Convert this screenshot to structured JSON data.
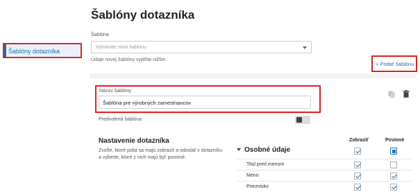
{
  "sidebar": {
    "items": [
      {
        "label": "Šablóny dotazníka",
        "active": true
      }
    ]
  },
  "main": {
    "title": "Šablóny dotazníka",
    "template_select": {
      "label": "Šablóna",
      "placeholder": "Vytvárate novú šablónu"
    },
    "hint": "Údaje novej šablóny vyplňte nižšie.",
    "add_button": "+ Pridať šablónu"
  },
  "card": {
    "name_label": "Názov šablóny",
    "name_value": "Šablóna pre výrobných zamestnancov",
    "default_label": "Predvolená šablóna",
    "default_toggle": false,
    "settings_title": "Nastavenie dotazníka",
    "settings_desc": "Zvoľte, ktoré polia sa majú zobraziť a odoslať v dotazníku a vyberte, ktoré z nich majú byť povinné.",
    "columns": {
      "show": "Zobraziť",
      "required": "Povinné"
    },
    "section": {
      "title": "Osobné údaje",
      "show": true,
      "required": "partial",
      "rows": [
        {
          "label": "Titul pred menom",
          "show": true,
          "required": false
        },
        {
          "label": "Meno",
          "show": true,
          "required": true
        },
        {
          "label": "Priezvisko",
          "show": true,
          "required": true
        }
      ]
    }
  },
  "colors": {
    "accent": "#1b6fb5",
    "highlight": "#e0201e"
  },
  "icons": [
    "copy-icon",
    "trash-icon",
    "caret-down-icon",
    "collapse-triangle-icon"
  ]
}
